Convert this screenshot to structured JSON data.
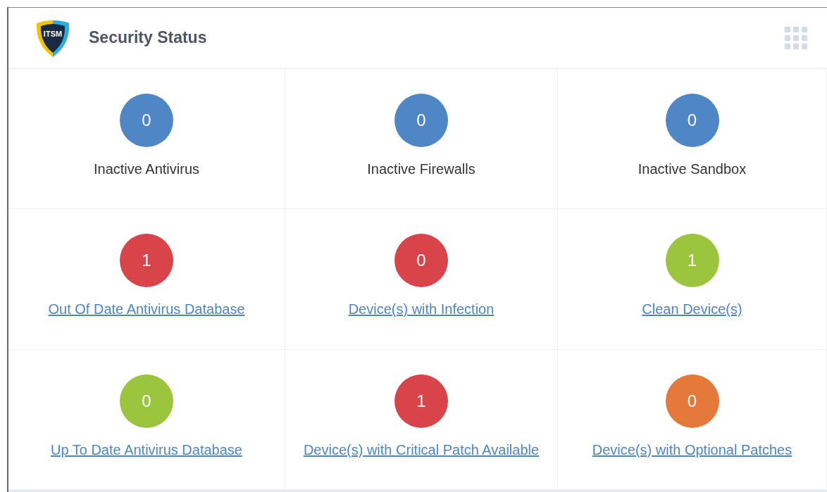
{
  "header": {
    "logo_text": "ITSM",
    "title": "Security Status"
  },
  "tiles": [
    {
      "count": "0",
      "label": "Inactive Antivirus",
      "kind": "text",
      "color": "#4f86c6"
    },
    {
      "count": "0",
      "label": "Inactive Firewalls",
      "kind": "text",
      "color": "#4f86c6"
    },
    {
      "count": "0",
      "label": "Inactive Sandbox",
      "kind": "text",
      "color": "#4f86c6"
    },
    {
      "count": "1",
      "label": "Out Of Date Antivirus Database",
      "kind": "link",
      "color": "#d9434a"
    },
    {
      "count": "0",
      "label": "Device(s) with Infection",
      "kind": "link",
      "color": "#d9434a"
    },
    {
      "count": "1",
      "label": "Clean Device(s)",
      "kind": "link",
      "color": "#9bc53d"
    },
    {
      "count": "0",
      "label": "Up To Date Antivirus Database",
      "kind": "link",
      "color": "#9bc53d"
    },
    {
      "count": "1",
      "label": "Device(s) with Critical Patch Available",
      "kind": "link",
      "color": "#d9434a"
    },
    {
      "count": "0",
      "label": "Device(s) with Optional Patches",
      "kind": "link",
      "color": "#e4793a"
    }
  ]
}
